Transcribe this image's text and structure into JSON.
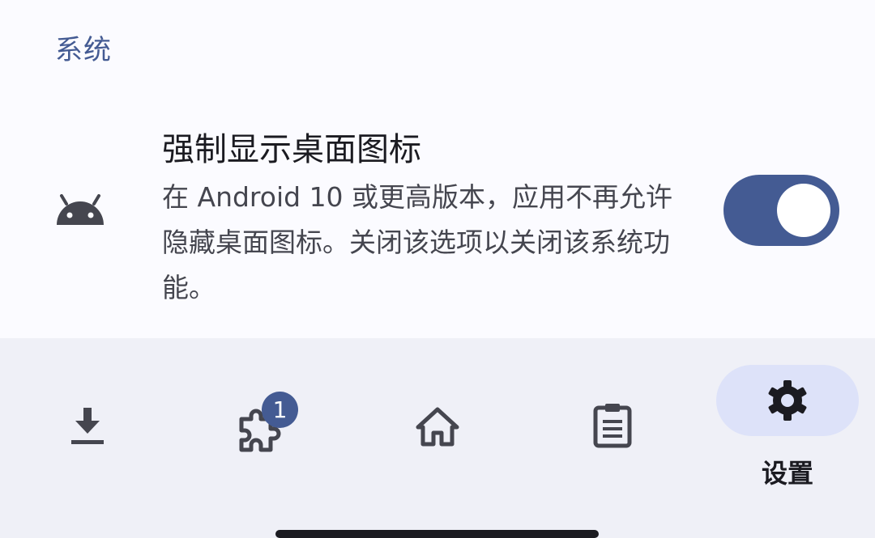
{
  "section": {
    "title": "系统"
  },
  "preference": {
    "icon": "android-icon",
    "title": "强制显示桌面图标",
    "summary": "在 Android 10 或更高版本，应用不再允许隐藏桌面图标。关闭该选项以关闭该系统功能。",
    "switch_on": true
  },
  "nav": {
    "items": [
      {
        "icon": "download-icon"
      },
      {
        "icon": "extension-icon",
        "badge": "1"
      },
      {
        "icon": "home-icon"
      },
      {
        "icon": "clipboard-list-icon"
      },
      {
        "icon": "gear-icon",
        "label": "设置",
        "selected": true
      }
    ]
  },
  "colors": {
    "accent": "#445b93",
    "indicator": "#dde2f9",
    "nav_bg": "#eff0f7",
    "bg": "#fbfbff"
  }
}
